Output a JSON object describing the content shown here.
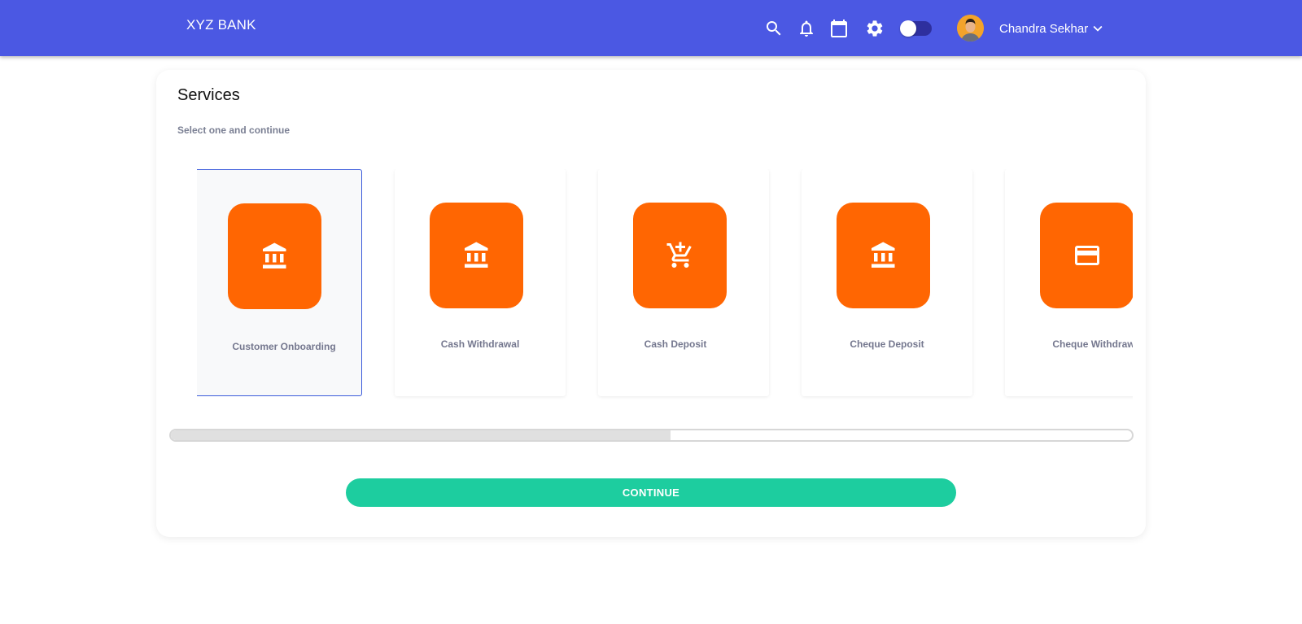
{
  "header": {
    "brand": "XYZ BANK",
    "icons": [
      "search-icon",
      "bell-icon",
      "calendar-icon",
      "gear-icon"
    ],
    "theme_toggle": {
      "on": false
    },
    "user": {
      "name": "Chandra Sekhar"
    }
  },
  "main": {
    "title": "Services",
    "subtitle": "Select one and continue",
    "services": [
      {
        "label": "Customer Onboarding",
        "icon": "bank-icon",
        "selected": true
      },
      {
        "label": "Cash Withdrawal",
        "icon": "bank-icon",
        "selected": false
      },
      {
        "label": "Cash Deposit",
        "icon": "add-cart-icon",
        "selected": false
      },
      {
        "label": "Cheque Deposit",
        "icon": "bank-icon",
        "selected": false
      },
      {
        "label": "Cheque Withdraw",
        "icon": "card-icon",
        "selected": false
      }
    ],
    "scroll_progress": 0.52,
    "continue_label": "CONTINUE"
  },
  "colors": {
    "header_bg": "#4b58e3",
    "tile_icon_bg": "#ff6602",
    "continue_bg": "#1dcd9f",
    "selected_border": "#3b5bdb"
  }
}
